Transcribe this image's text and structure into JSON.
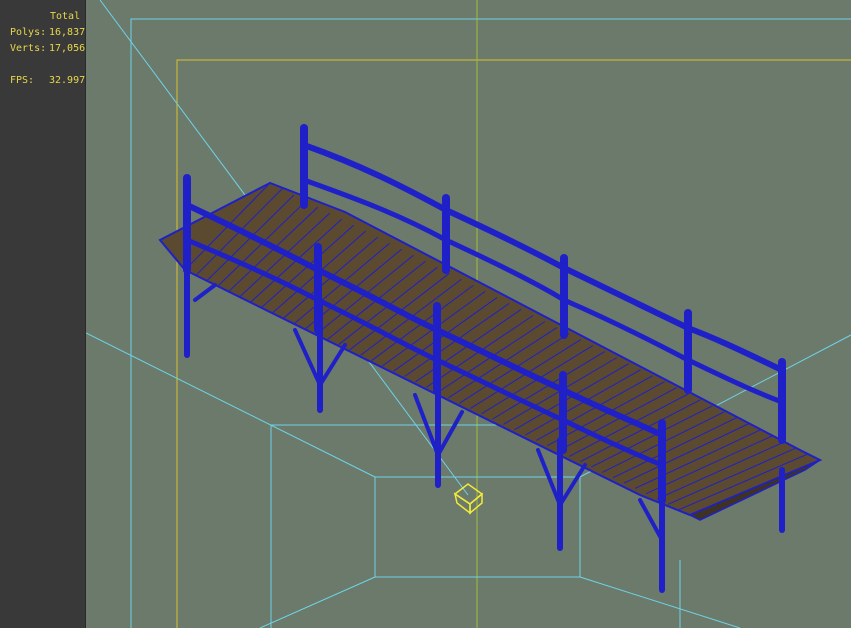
{
  "hud": {
    "header": "Total",
    "polys_label": "Polys:",
    "polys_value": "16,837",
    "verts_label": "Verts:",
    "verts_value": "17,056",
    "fps_label": "FPS:",
    "fps_value": "32.997"
  },
  "colors": {
    "viewport_bg": "#6b7a6b",
    "panel_bg": "#393939",
    "hud_text": "#e8d84a",
    "wire": "#1f20c8",
    "wood": "#5b4a2f",
    "guide_cyan": "#6fd3e6",
    "guide_yellow": "#d8c22e",
    "axis_green": "#9fbf3a"
  }
}
